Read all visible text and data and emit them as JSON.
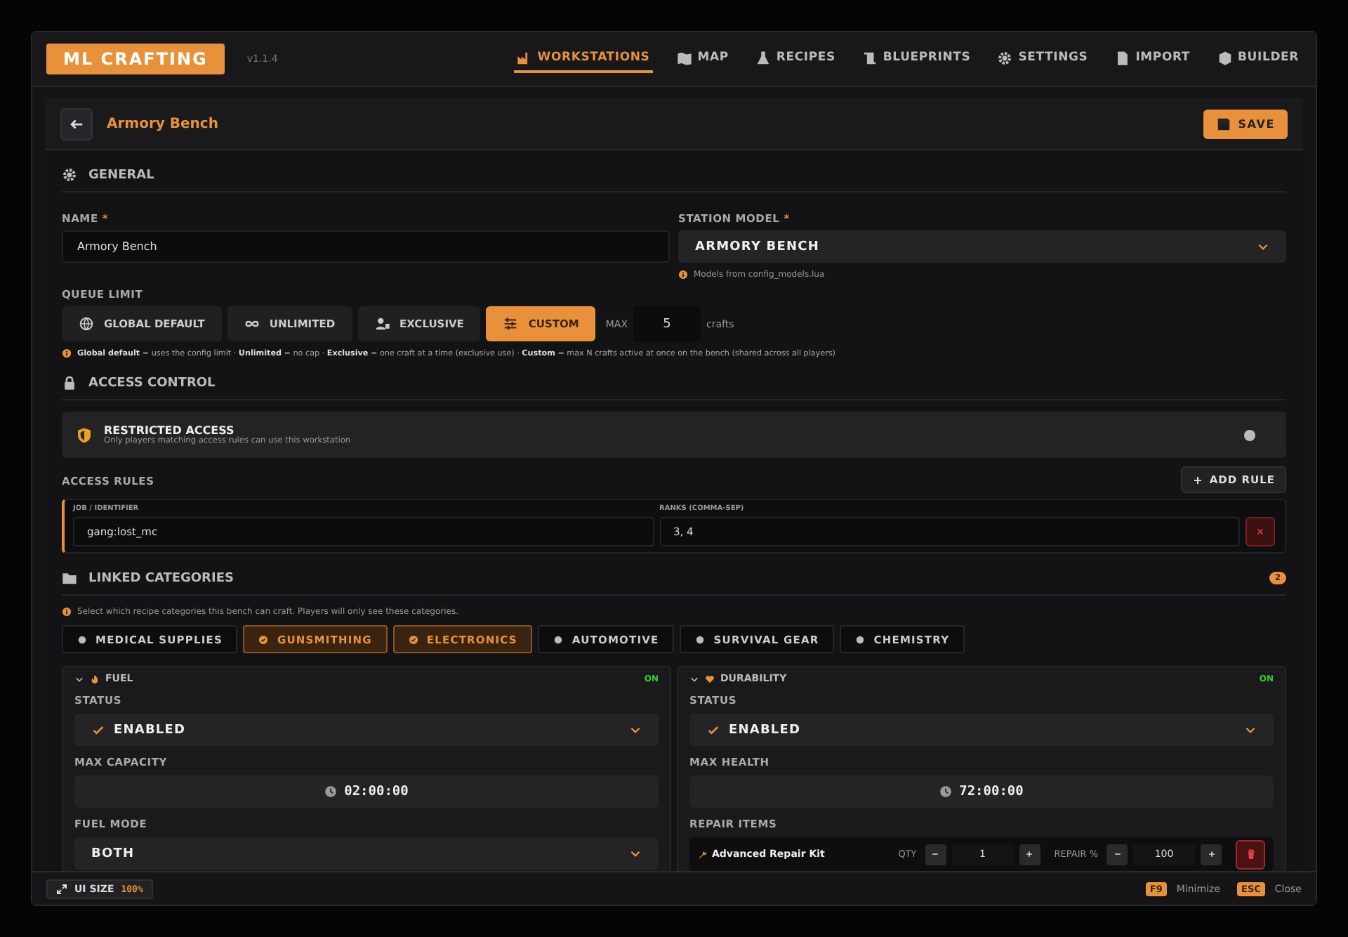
{
  "app": {
    "logo": "ML CRAFTING",
    "version": "v1.1.4"
  },
  "nav": [
    {
      "label": "WORKSTATIONS",
      "selected": true
    },
    {
      "label": "MAP",
      "selected": false
    },
    {
      "label": "RECIPES",
      "selected": false
    },
    {
      "label": "BLUEPRINTS",
      "selected": false
    },
    {
      "label": "SETTINGS",
      "selected": false
    },
    {
      "label": "IMPORT",
      "selected": false
    },
    {
      "label": "BUILDER",
      "selected": false
    }
  ],
  "header": {
    "title": "Armory Bench",
    "save": "SAVE"
  },
  "general": {
    "title": "GENERAL",
    "name": {
      "label": "NAME",
      "required": "*",
      "value": "Armory Bench"
    },
    "model": {
      "label": "STATION MODEL",
      "required": "*",
      "value": "ARMORY BENCH",
      "hint": "Models from config_models.lua"
    },
    "queue": {
      "label": "QUEUE LIMIT",
      "options": [
        {
          "label": "GLOBAL DEFAULT",
          "selected": false
        },
        {
          "label": "UNLIMITED",
          "selected": false
        },
        {
          "label": "EXCLUSIVE",
          "selected": false
        },
        {
          "label": "CUSTOM",
          "selected": true
        }
      ],
      "max_label": "MAX",
      "max_value": "5",
      "unit": "crafts",
      "note": "**Global default** = uses the config limit · **Unlimited** = no cap · **Exclusive** = one craft at a time (exclusive use) · **Custom** = max N crafts active at once on the bench (shared across all players)"
    }
  },
  "access": {
    "title": "ACCESS CONTROL",
    "restricted": {
      "title": "RESTRICTED ACCESS",
      "description": "Only players matching access rules can use this workstation",
      "on": false
    },
    "rules_label": "ACCESS RULES",
    "add_rule": "ADD RULE",
    "rule_columns": [
      "JOB / IDENTIFIER",
      "RANKS (COMMA-SEP)"
    ],
    "rules": [
      {
        "identifier": "gang:lost_mc",
        "ranks": "3, 4"
      }
    ]
  },
  "categories": {
    "title": "LINKED CATEGORIES",
    "count": "2",
    "hint": "Select which recipe categories this bench can craft. Players will only see these categories.",
    "items": [
      {
        "label": "MEDICAL SUPPLIES",
        "selected": false
      },
      {
        "label": "GUNSMITHING",
        "selected": true
      },
      {
        "label": "ELECTRONICS",
        "selected": true
      },
      {
        "label": "AUTOMOTIVE",
        "selected": false
      },
      {
        "label": "SURVIVAL GEAR",
        "selected": false
      },
      {
        "label": "CHEMISTRY",
        "selected": false
      }
    ]
  },
  "modules": [
    {
      "title": "FUEL",
      "status": "ON",
      "expanded": true,
      "fields": [
        {
          "kind": "select",
          "label": "STATUS",
          "value": "ENABLED",
          "checked": true
        },
        {
          "kind": "time",
          "label": "MAX CAPACITY",
          "value": "02:00:00"
        },
        {
          "kind": "select",
          "label": "FUEL MODE",
          "value": "BOTH",
          "checked": false
        }
      ]
    },
    {
      "title": "DURABILITY",
      "status": "ON",
      "expanded": true,
      "fields": [
        {
          "kind": "select",
          "label": "STATUS",
          "value": "ENABLED",
          "checked": true
        },
        {
          "kind": "time",
          "label": "MAX HEALTH",
          "value": "72:00:00"
        },
        {
          "kind": "items",
          "label": "REPAIR ITEMS",
          "items": [
            {
              "name": "Advanced Repair Kit",
              "qty_label": "QTY",
              "qty": "1",
              "repair_label": "REPAIR %",
              "repair": "100"
            }
          ]
        }
      ]
    }
  ],
  "footer": {
    "size_label": "UI SIZE",
    "size_value": "100%",
    "shortcuts": [
      {
        "key": "F9",
        "label": "Minimize"
      },
      {
        "key": "ESC",
        "label": "Close"
      }
    ]
  }
}
